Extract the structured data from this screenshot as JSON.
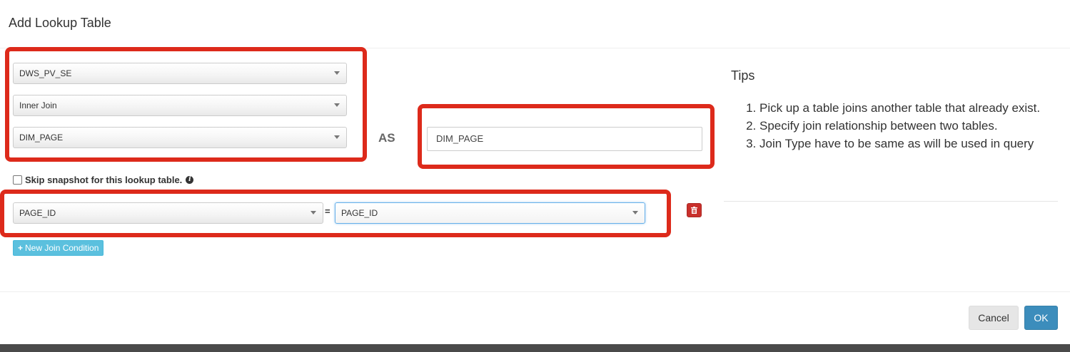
{
  "dialog": {
    "title": "Add Lookup Table"
  },
  "form": {
    "source_table": "DWS_PV_SE",
    "join_type": "Inner Join",
    "lookup_table": "DIM_PAGE",
    "as_label": "AS",
    "alias_value": "DIM_PAGE",
    "skip_snapshot_label": "Skip snapshot for this lookup table.",
    "skip_snapshot_checked": false,
    "join_condition": {
      "left_column": "PAGE_ID",
      "operator": "=",
      "right_column": "PAGE_ID"
    },
    "new_join_label": "New Join Condition"
  },
  "tips": {
    "title": "Tips",
    "items": [
      "Pick up a table joins another table that already exist.",
      "Specify join relationship between two tables.",
      "Join Type have to be same as will be used in query"
    ]
  },
  "footer": {
    "cancel_label": "Cancel",
    "ok_label": "OK"
  },
  "colors": {
    "highlight_border": "#dd2a1b",
    "ok_button": "#3c8dbc",
    "delete_button": "#c9302c",
    "new_join_button": "#5bc0de"
  }
}
